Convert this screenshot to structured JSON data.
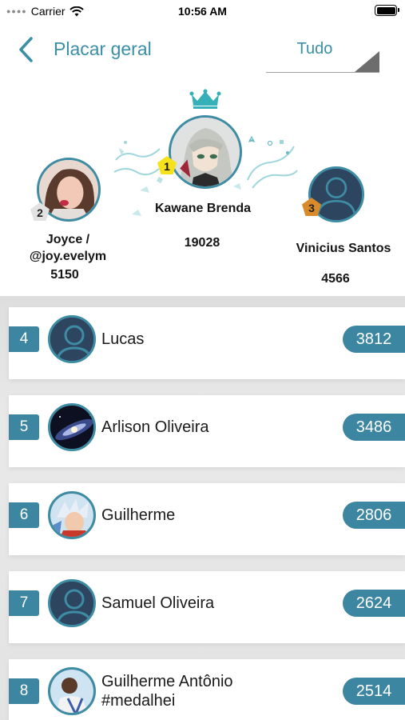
{
  "status_bar": {
    "carrier": "Carrier",
    "time": "10:56 AM"
  },
  "header": {
    "title": "Placar geral",
    "filter_label": "Tudo"
  },
  "podium": {
    "first": {
      "rank": "1",
      "name": "Kawane Brenda",
      "score": "19028"
    },
    "second": {
      "rank": "2",
      "name_line1": "Joyce /",
      "name_line2": "@joy.evelym",
      "score": "5150"
    },
    "third": {
      "rank": "3",
      "name": "Vinicius Santos",
      "score": "4566"
    }
  },
  "ranking": [
    {
      "rank": "4",
      "name": "Lucas",
      "score": "3812",
      "avatar": "default-person"
    },
    {
      "rank": "5",
      "name": "Arlison Oliveira",
      "score": "3486",
      "avatar": "galaxy-photo"
    },
    {
      "rank": "6",
      "name": "Guilherme",
      "score": "2806",
      "avatar": "anime-photo"
    },
    {
      "rank": "7",
      "name": "Samuel Oliveira",
      "score": "2624",
      "avatar": "default-person"
    },
    {
      "rank": "8",
      "name_line1": "Guilherme Antônio",
      "name_line2": "#medalhei",
      "score": "2514",
      "avatar": "person-photo"
    }
  ],
  "colors": {
    "accent": "#3a8fa6",
    "badge": "#3d86a2",
    "gold": "#f5e21a",
    "bronze": "#d98a2b"
  }
}
